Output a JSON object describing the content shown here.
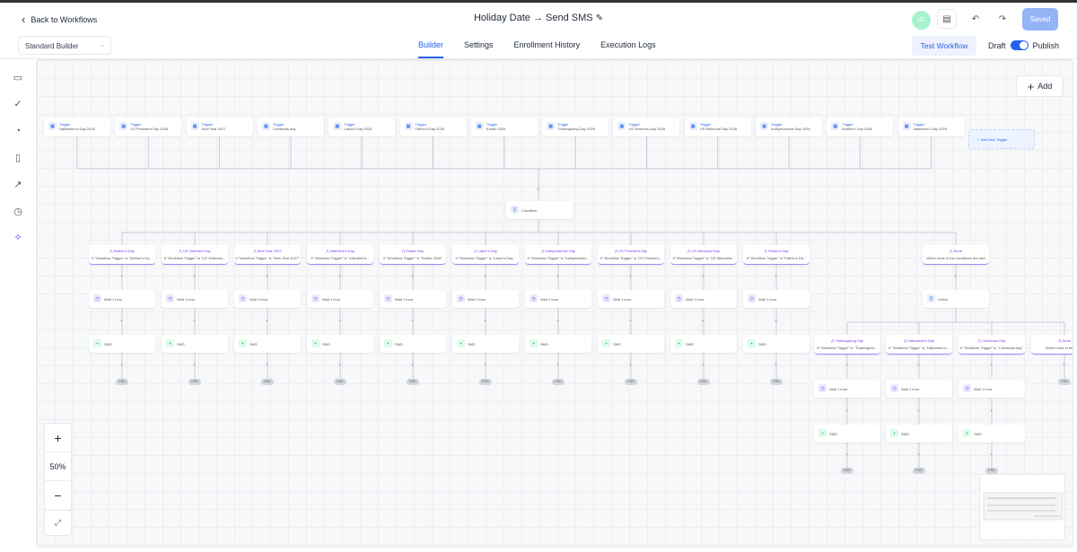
{
  "header": {
    "back_label": "Back to Workflows",
    "title": "Holiday Date → Send SMS",
    "avatar_initials": "IG",
    "saved_label": "Saved"
  },
  "toolbar": {
    "builder_mode": "Standard Builder",
    "tabs": [
      {
        "label": "Builder",
        "active": true
      },
      {
        "label": "Settings"
      },
      {
        "label": "Enrollment History"
      },
      {
        "label": "Execution Logs"
      }
    ],
    "test_workflow": "Test Workflow",
    "draft_label": "Draft",
    "publish_label": "Publish",
    "published": true
  },
  "canvas": {
    "add_label": "Add",
    "zoom_level": "50%",
    "trigger_kind": "Trigger",
    "triggers": [
      "Halloween's Day 2026",
      "US President Day 2026",
      "New Year 2027",
      "Christmas day",
      "Labor's Day 2026",
      "Father's Day 2026",
      "Easter 2026",
      "Thanksgiving Day 2026",
      "US Veterans Day 2026",
      "US Memorial Day 2026",
      "Independence Day 2026",
      "Mother's Day 2026",
      "Valentine's Day 2026"
    ],
    "add_trigger_label": "Add New Trigger",
    "condition_label": "Condition",
    "branches": [
      {
        "title": "Mother's Day",
        "desc": "If \"Workflow Trigger\" is \"Mother's Da..."
      },
      {
        "title": "US Veterans Day",
        "desc": "If \"Workflow Trigger\" is \"US Veterans..."
      },
      {
        "title": "New Year 2027",
        "desc": "If \"Workflow Trigger\" is \"New Year 2027\""
      },
      {
        "title": "Valentine's Day",
        "desc": "If \"Workflow Trigger\" is \"Valentine's..."
      },
      {
        "title": "Easter Day",
        "desc": "If \"Workflow Trigger\" is \"Easter 2026\""
      },
      {
        "title": "Labor's Day",
        "desc": "If \"Workflow Trigger\" is \"Labor's Day..."
      },
      {
        "title": "Independence Day",
        "desc": "If \"Workflow Trigger\" is \"Independenc..."
      },
      {
        "title": "US President Day",
        "desc": "If \"Workflow Trigger\" is \"US Presiden..."
      },
      {
        "title": "US Memorial Day",
        "desc": "If \"Workflow Trigger\" is \"US Memorial..."
      },
      {
        "title": "Father's Day",
        "desc": "If \"Workflow Trigger\" is \"Father's Da..."
      }
    ],
    "none_branch": {
      "title": "None",
      "desc": "When none of the conditions are met"
    },
    "check_label": "Check",
    "sub_branches": [
      {
        "title": "Thanksgiving Day",
        "desc": "If \"Workflow Trigger\" is \"Thanksgivin..."
      },
      {
        "title": "Halloween's Day",
        "desc": "If \"Workflow Trigger\" is \"Halloween's..."
      },
      {
        "title": "Christmas Day",
        "desc": "If \"Workflow Trigger\" is \"Christmas day\""
      },
      {
        "title": "None",
        "desc": "When none of the condi"
      }
    ],
    "wait_label": "Wait 1 hour",
    "sms_label": "SMS",
    "end_label": "END"
  },
  "colors": {
    "accent": "#2563eb",
    "branch": "#7c3aed",
    "sms": "#16a34a"
  }
}
